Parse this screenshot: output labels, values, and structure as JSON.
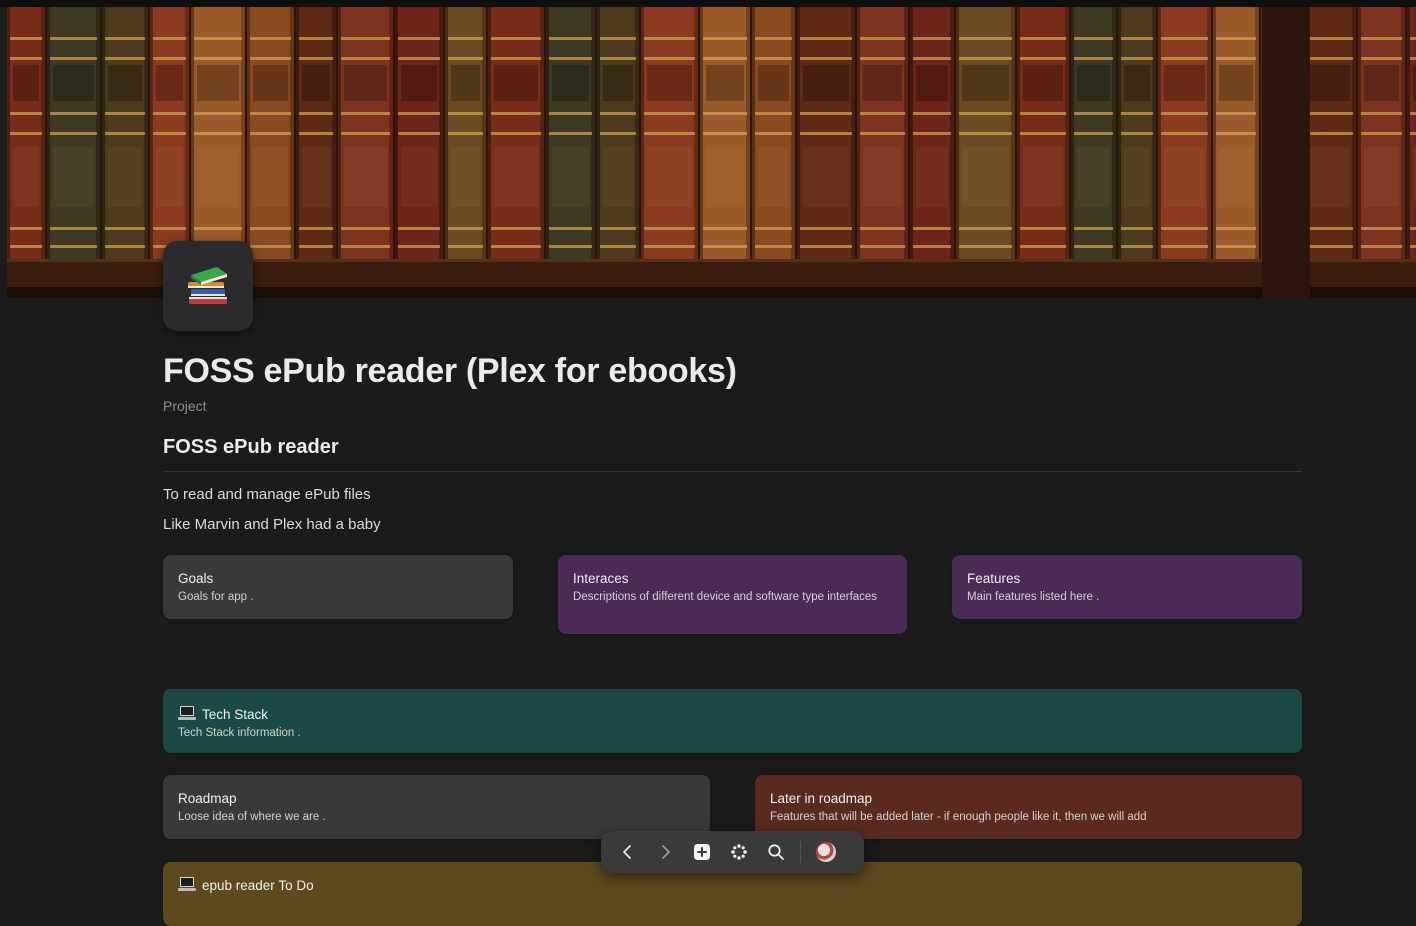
{
  "page": {
    "title": "FOSS ePub reader (Plex for ebooks)",
    "type_label": "Project",
    "icon": "books-icon"
  },
  "content": {
    "heading": "FOSS ePub reader",
    "paragraphs": [
      "To read and manage ePub files",
      "Like Marvin and Plex had a baby"
    ]
  },
  "cards": {
    "goals": {
      "title": "Goals",
      "desc": "Goals for app ."
    },
    "interfaces": {
      "title": "Interaces",
      "desc": "Descriptions of different device and software type interfaces"
    },
    "features": {
      "title": "Features",
      "desc": "Main features listed here ."
    },
    "tech_stack": {
      "title": "Tech Stack",
      "desc": "Tech Stack information .",
      "icon": "laptop-icon"
    },
    "roadmap": {
      "title": "Roadmap",
      "desc": "Loose idea of where we are ."
    },
    "later_roadmap": {
      "title": "Later in roadmap",
      "desc": "Features that will be added later - if enough people like it, then we will add"
    },
    "todo": {
      "title": "epub reader To Do",
      "icon": "laptop-icon"
    }
  },
  "toolbar": {
    "items": [
      "back-icon",
      "forward-icon",
      "new-page-icon",
      "apps-icon",
      "search-icon",
      "avatar"
    ]
  },
  "colors": {
    "background": "#1b1b1c",
    "card_gray": "#373a3b",
    "card_purple": "#482c55",
    "card_teal": "#1a4a47",
    "card_brown": "#5a2a1f",
    "card_mustard": "#5c4a1c"
  }
}
